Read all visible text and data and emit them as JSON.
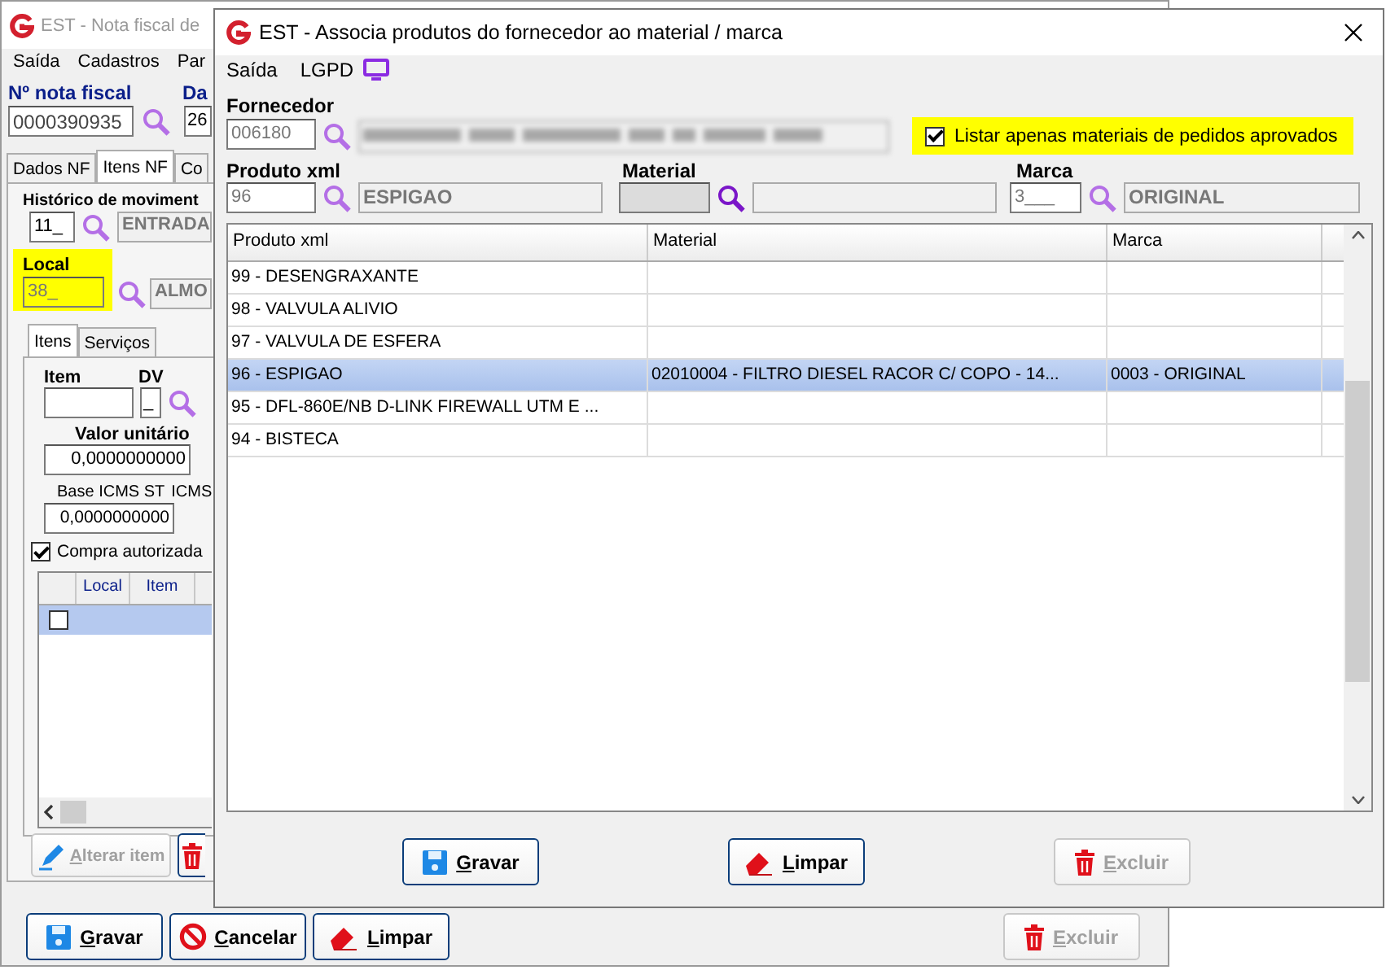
{
  "back_window": {
    "title": "EST - Nota fiscal de",
    "menu": [
      "Saída",
      "Cadastros",
      "Par"
    ],
    "nota_fiscal": {
      "label": "Nº nota fiscal",
      "value": "0000390935"
    },
    "data": {
      "label": "Da",
      "value": "26"
    },
    "tabs": [
      {
        "label": "Dados NF",
        "selected": false
      },
      {
        "label": "Itens NF",
        "selected": true
      },
      {
        "label": "Co",
        "selected": false
      }
    ],
    "historico": {
      "label": "Histórico de moviment",
      "code": "11_",
      "description": "ENTRADA"
    },
    "local": {
      "label": "Local",
      "code": "38_",
      "description": "ALMO",
      "highlighted": true
    },
    "sub_tabs": [
      {
        "label": "Itens",
        "selected": true
      },
      {
        "label": "Serviços",
        "selected": false
      }
    ],
    "item": {
      "label": "Item"
    },
    "dv": {
      "label": "DV",
      "value": "_"
    },
    "valor_unitario": {
      "label": "Valor unitário",
      "value": "0,0000000000"
    },
    "base_icms_st": {
      "label": "Base ICMS ST",
      "value": "0,0000000000"
    },
    "icms": {
      "label": "ICMS"
    },
    "compra_autorizada": {
      "label": "Compra autorizada",
      "checked": true
    },
    "grid": {
      "columns": [
        "Local",
        "Item"
      ],
      "rows": [
        {
          "checked": false,
          "selected": true
        }
      ]
    },
    "item_buttons": [
      {
        "kind": "edit",
        "label": "Alterar item",
        "disabled": true
      },
      {
        "kind": "delete",
        "disabled": false
      }
    ],
    "buttons": [
      {
        "kind": "save",
        "label": "Gravar",
        "disabled": false
      },
      {
        "kind": "cancel",
        "label": "Cancelar",
        "disabled": false
      },
      {
        "kind": "clear",
        "label": "Limpar",
        "disabled": false
      },
      {
        "kind": "delete",
        "label": "Excluir",
        "disabled": true
      }
    ]
  },
  "front_window": {
    "title": "EST - Associa produtos do fornecedor ao material / marca",
    "menu": [
      "Saída",
      "LGPD"
    ],
    "fornecedor": {
      "label": "Fornecedor",
      "code": "006180"
    },
    "listar_aprovados": {
      "label": "Listar apenas materiais de pedidos aprovados",
      "checked": true,
      "highlighted": true
    },
    "produto_xml": {
      "label": "Produto xml",
      "code": "96",
      "description": "ESPIGAO"
    },
    "material": {
      "label": "Material"
    },
    "marca": {
      "label": "Marca",
      "code": "3___",
      "description": "ORIGINAL"
    },
    "table": {
      "columns": [
        "Produto xml",
        "Material",
        "Marca"
      ],
      "rows": [
        {
          "produto_xml": "99 - DESENGRAXANTE",
          "selected": false
        },
        {
          "produto_xml": "98 - VALVULA ALIVIO",
          "selected": false
        },
        {
          "produto_xml": "97 - VALVULA DE ESFERA",
          "selected": false
        },
        {
          "produto_xml": "96 - ESPIGAO",
          "material": "02010004 - FILTRO DIESEL RACOR C/ COPO - 14...",
          "marca": "0003 - ORIGINAL",
          "selected": true
        },
        {
          "produto_xml": "95 - DFL-860E/NB D-LINK FIREWALL UTM E ...",
          "selected": false
        },
        {
          "produto_xml": "94 - BISTECA",
          "selected": false
        }
      ]
    },
    "buttons": [
      {
        "kind": "save",
        "label": "Gravar",
        "disabled": false
      },
      {
        "kind": "clear",
        "label": "Limpar",
        "disabled": false
      },
      {
        "kind": "delete",
        "label": "Excluir",
        "disabled": true
      }
    ]
  }
}
